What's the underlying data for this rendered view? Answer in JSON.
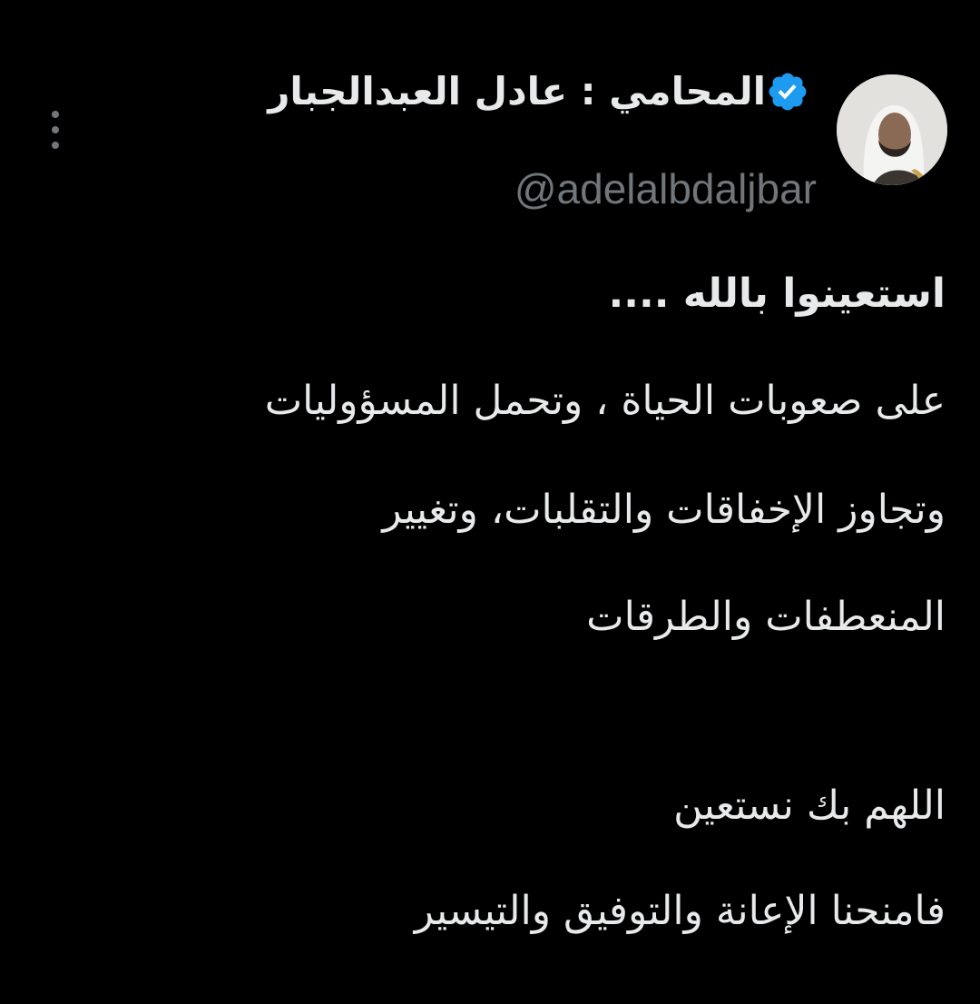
{
  "tweet": {
    "display_name": "المحامي : عادل العبدالجبار",
    "handle": "@adelalbdaljbar",
    "verified": true,
    "verified_color": "#1d9bf0",
    "more_icon": "more-vertical-icon",
    "avatar_icon": "profile-avatar",
    "text_lines": [
      "استعينوا بالله   ....",
      "على صعوبات الحياة ، وتحمل المسؤوليات",
      "وتجاوز الإخفاقات والتقلبات، وتغيير",
      "المنعطفات والطرقات",
      "اللهم بك نستعين",
      "فامنحنا الإعانة والتوفيق والتيسير"
    ]
  },
  "colors": {
    "background": "#000000",
    "text": "#e7e9ea",
    "secondary": "#71767b"
  }
}
